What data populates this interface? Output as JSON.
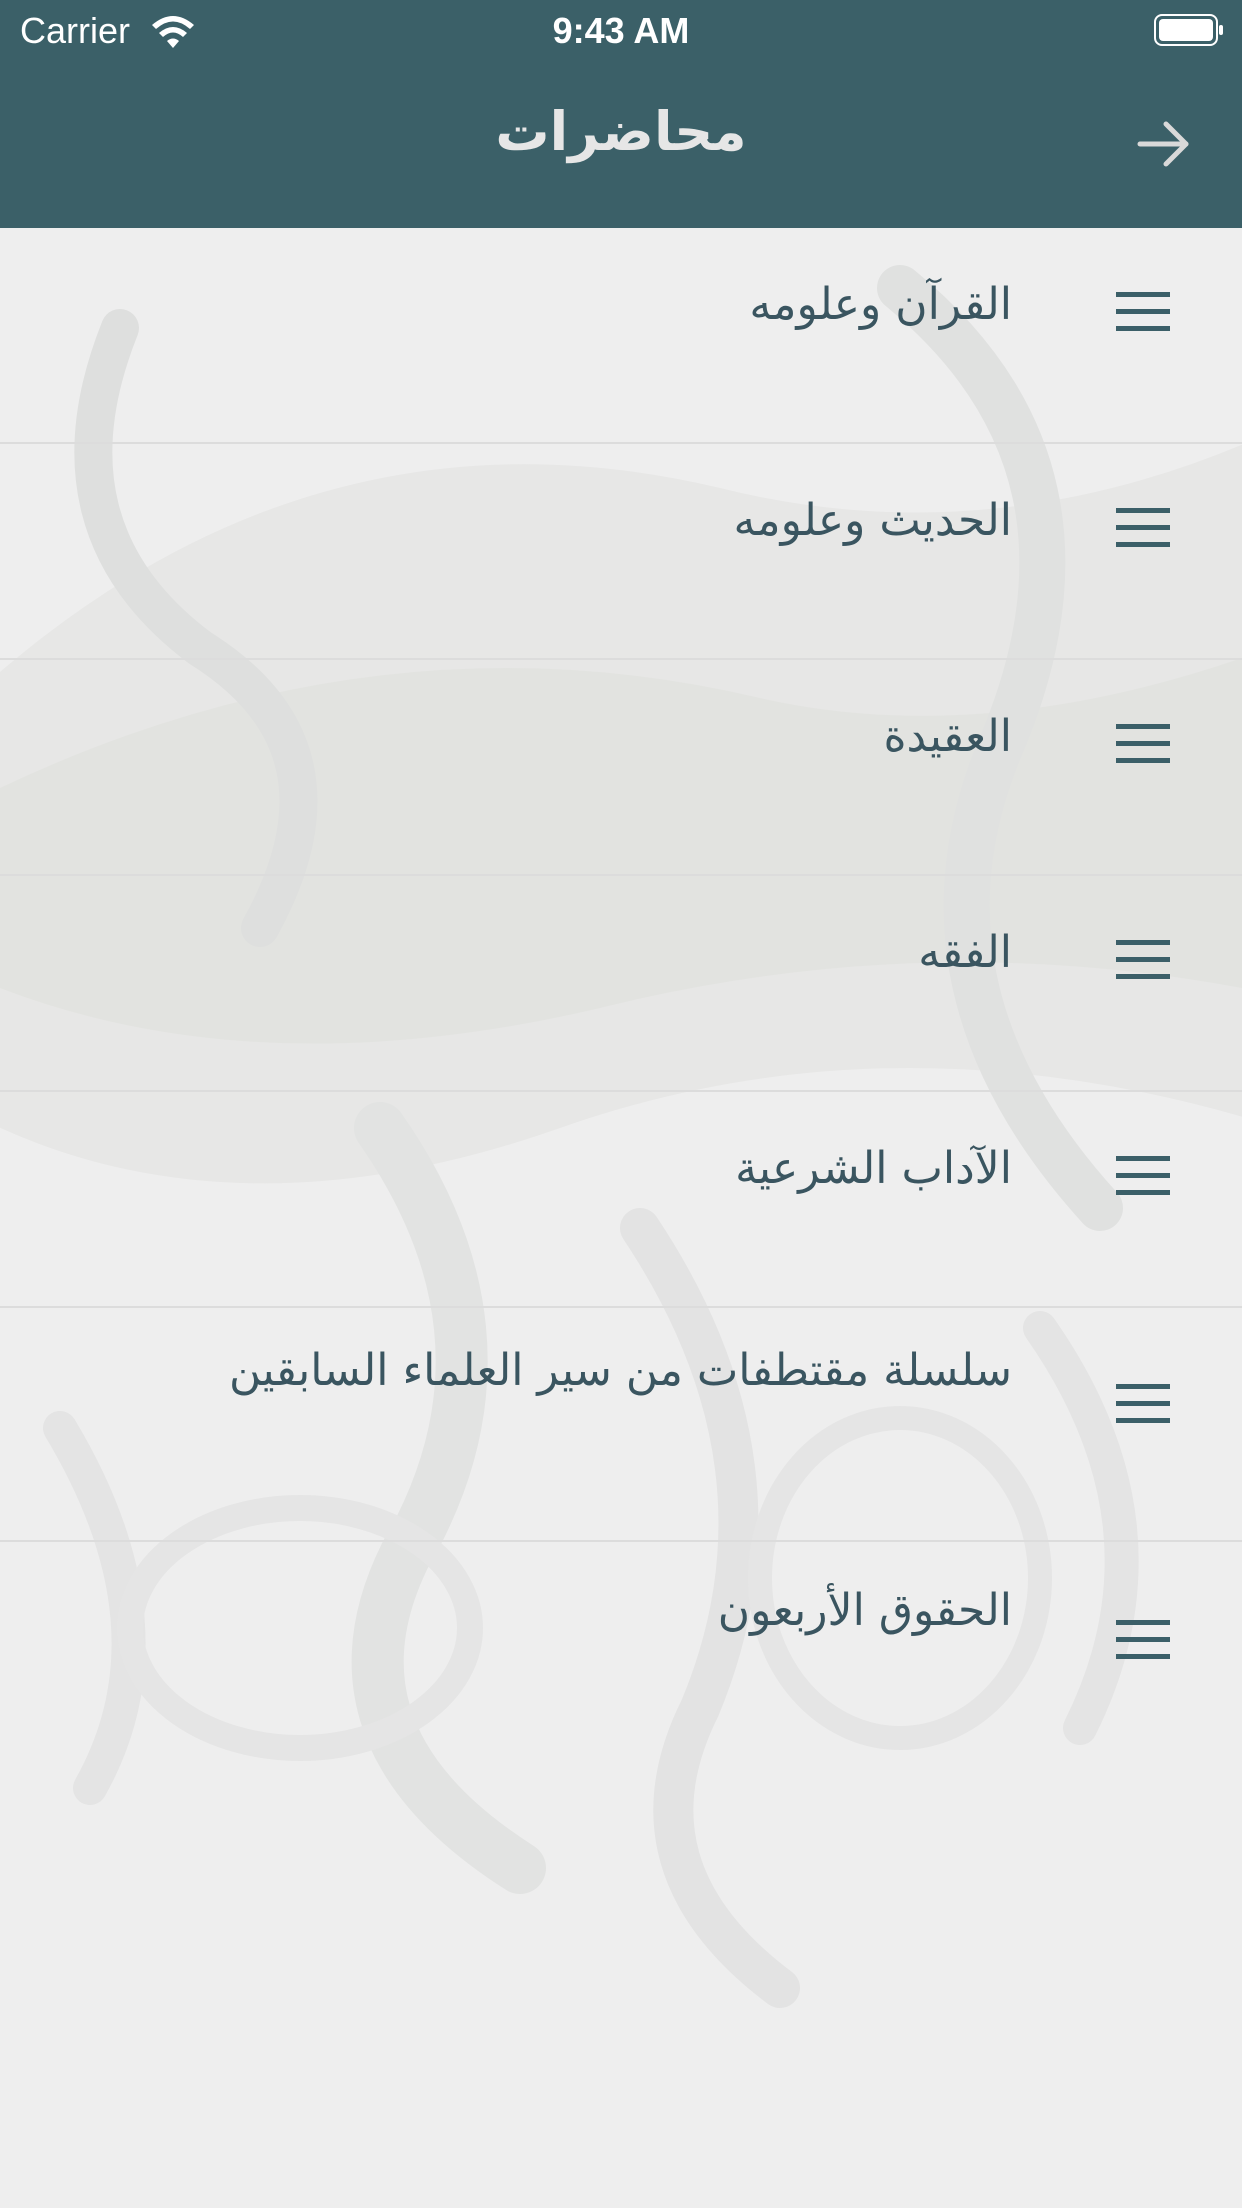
{
  "status_bar": {
    "carrier": "Carrier",
    "time": "9:43 AM"
  },
  "nav": {
    "title": "محاضرات",
    "back_icon": "arrow-right-icon"
  },
  "colors": {
    "header": "#3b6068",
    "text": "#3a5560",
    "background": "#eeeeee"
  },
  "categories": [
    {
      "label": "القرآن وعلومه",
      "icon": "menu-lines-icon"
    },
    {
      "label": "الحديث وعلومه",
      "icon": "menu-lines-icon"
    },
    {
      "label": "العقيدة",
      "icon": "menu-lines-icon"
    },
    {
      "label": "الفقه",
      "icon": "menu-lines-icon"
    },
    {
      "label": "الآداب الشرعية",
      "icon": "menu-lines-icon"
    },
    {
      "label": "سلسلة مقتطفات من سير العلماء السابقين",
      "icon": "menu-lines-icon"
    },
    {
      "label": "الحقوق الأربعون",
      "icon": "menu-lines-icon"
    }
  ]
}
